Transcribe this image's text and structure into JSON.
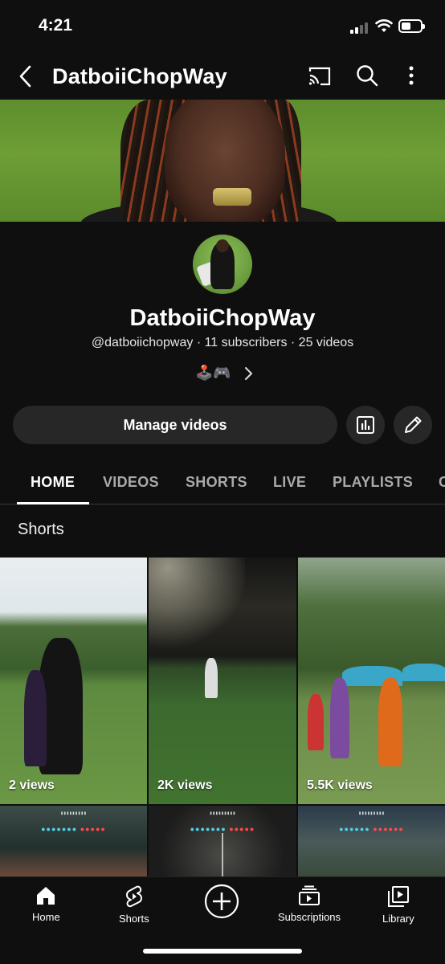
{
  "status_bar": {
    "time": "4:21"
  },
  "header": {
    "title": "DatboiiChopWay",
    "back_icon": "chevron-left-icon",
    "cast_icon": "cast-icon",
    "search_icon": "search-icon",
    "more_icon": "more-vert-icon"
  },
  "channel": {
    "name": "DatboiiChopWay",
    "meta": "@datboiichopway · 11 subscribers · 25 videos",
    "emojis": "🕹️🎮"
  },
  "actions": {
    "manage_label": "Manage videos",
    "analytics_icon": "analytics-icon",
    "edit_icon": "pencil-icon"
  },
  "tabs": [
    {
      "label": "HOME"
    },
    {
      "label": "VIDEOS"
    },
    {
      "label": "SHORTS"
    },
    {
      "label": "LIVE"
    },
    {
      "label": "PLAYLISTS"
    },
    {
      "label": "C"
    }
  ],
  "active_tab": "HOME",
  "shorts": {
    "section_title": "Shorts",
    "items": [
      {
        "views": "2 views"
      },
      {
        "views": "2K views"
      },
      {
        "views": "5.5K views"
      },
      {
        "views": ""
      },
      {
        "views": ""
      },
      {
        "views": ""
      }
    ]
  },
  "bottom_nav": [
    {
      "label": "Home",
      "icon": "home-icon"
    },
    {
      "label": "Shorts",
      "icon": "shorts-icon"
    },
    {
      "label": "",
      "icon": "create-plus-icon"
    },
    {
      "label": "Subscriptions",
      "icon": "subscriptions-icon"
    },
    {
      "label": "Library",
      "icon": "library-icon"
    }
  ],
  "colors": {
    "background": "#0f0f0f",
    "button": "#272727",
    "text_secondary": "#aaaaaa"
  }
}
